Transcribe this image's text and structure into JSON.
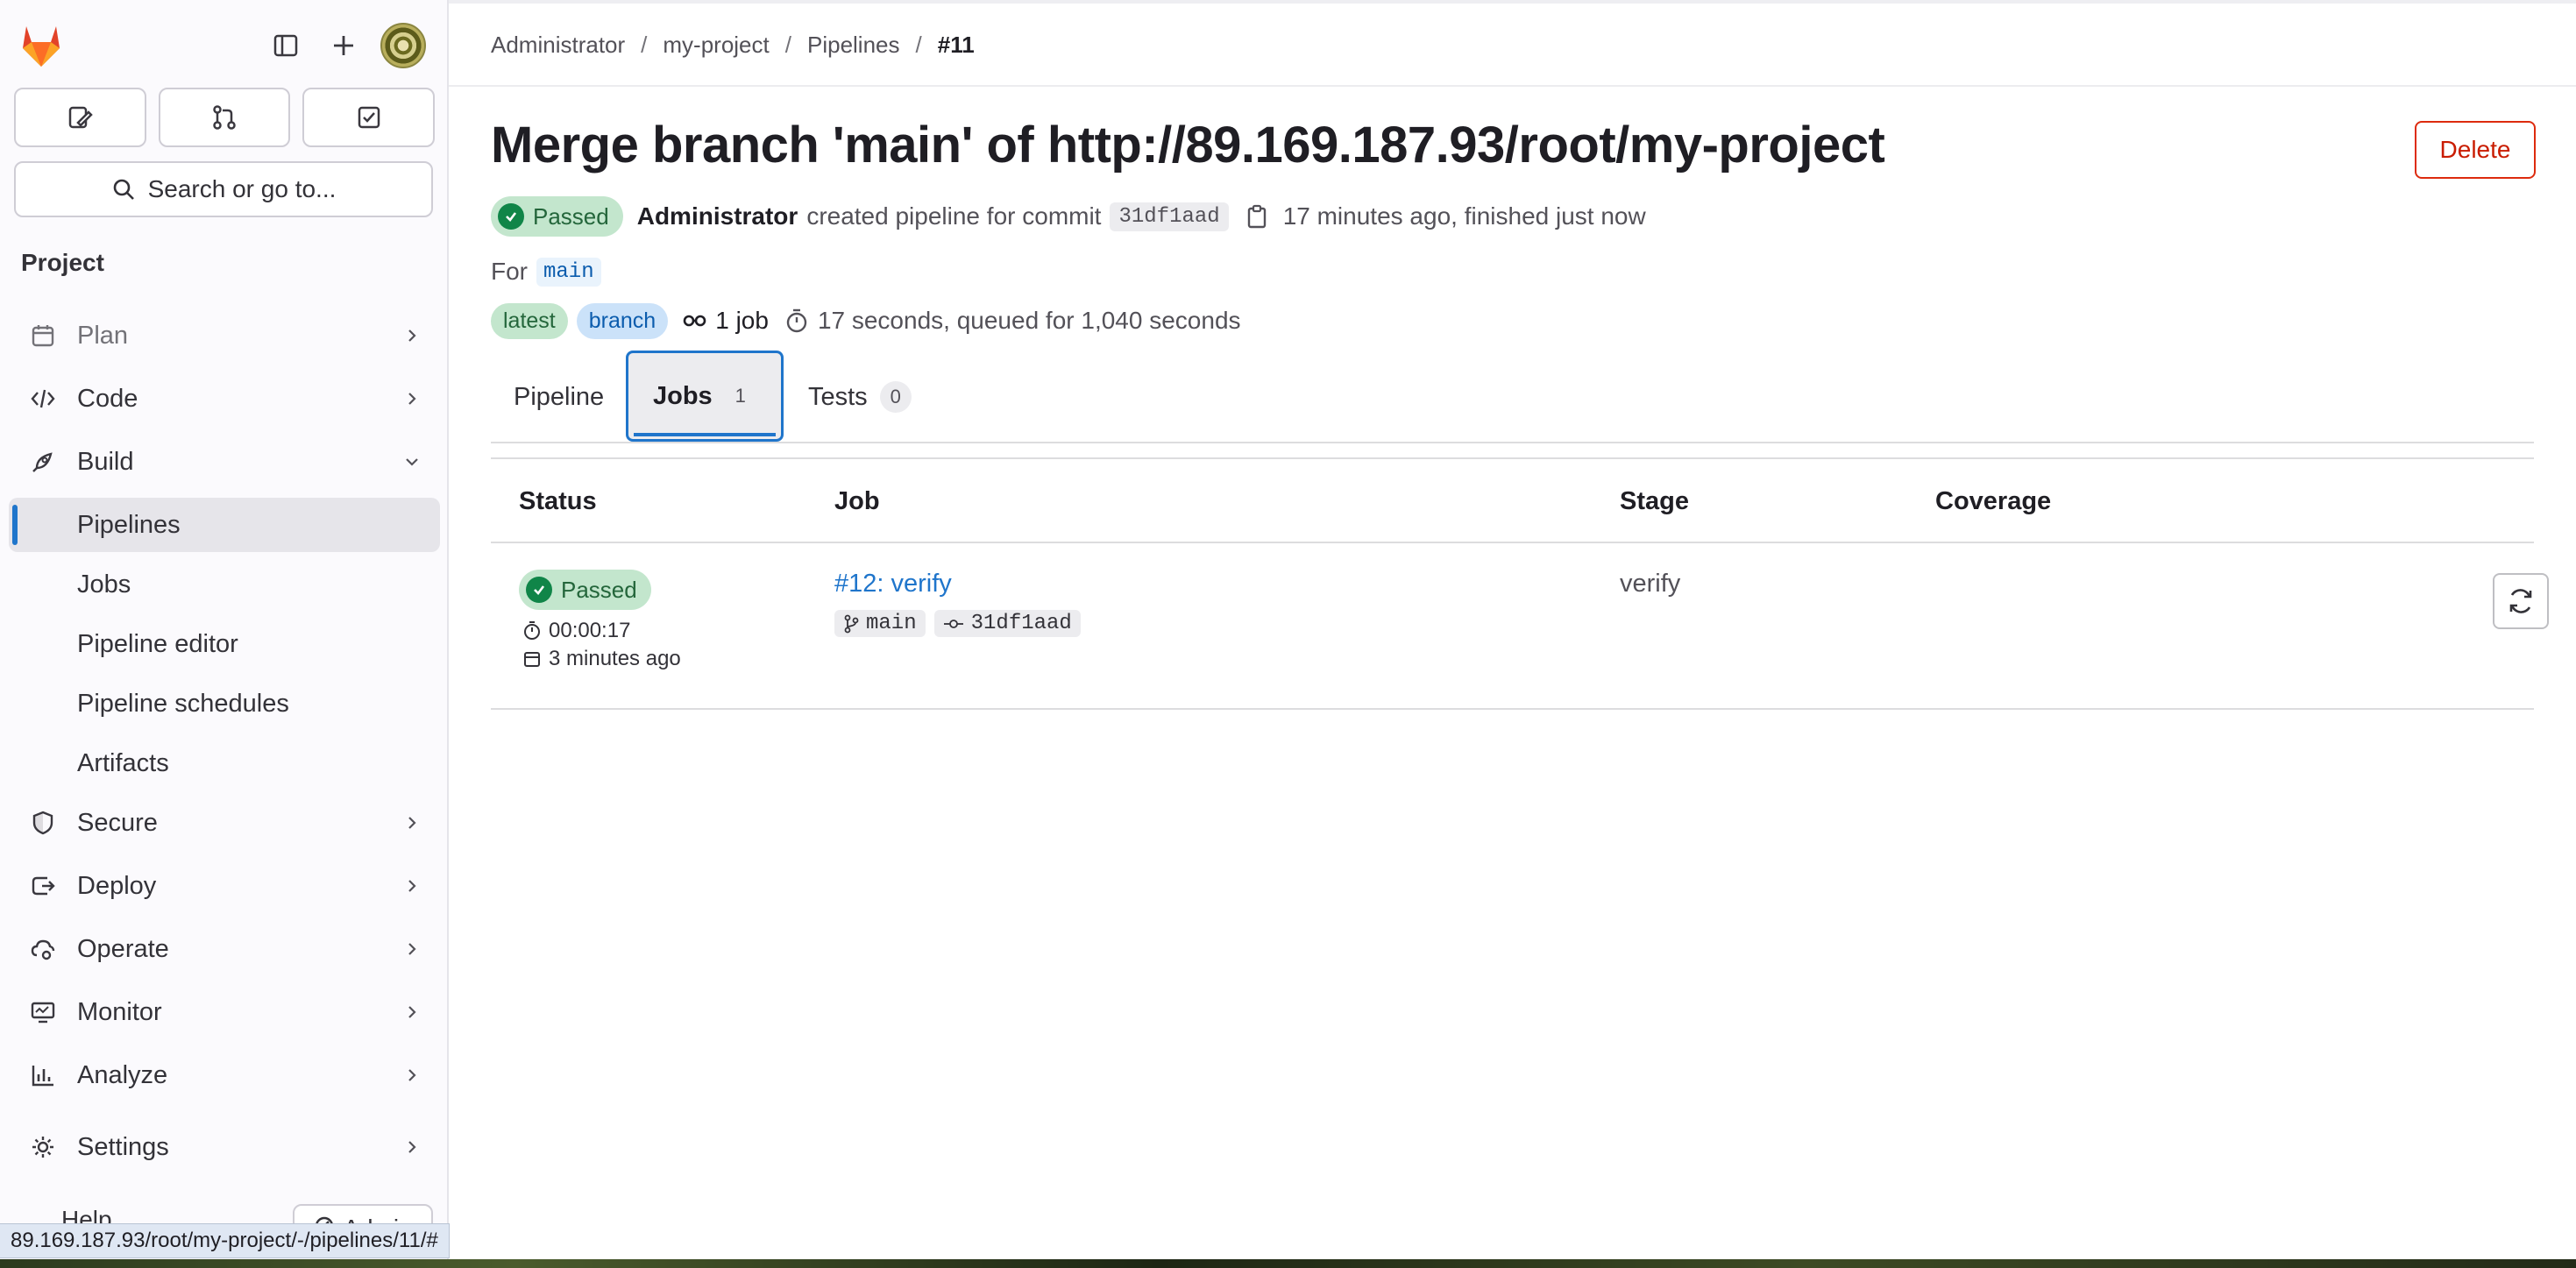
{
  "sidebar": {
    "section_title": "Project",
    "search_label": "Search or go to...",
    "nav": [
      {
        "label": "Plan",
        "icon": "calendar-icon"
      },
      {
        "label": "Code",
        "icon": "code-icon"
      },
      {
        "label": "Build",
        "icon": "rocket-icon"
      },
      {
        "label": "Secure",
        "icon": "shield-icon"
      },
      {
        "label": "Deploy",
        "icon": "deploy-icon"
      },
      {
        "label": "Operate",
        "icon": "cloud-gear-icon"
      },
      {
        "label": "Monitor",
        "icon": "monitor-icon"
      },
      {
        "label": "Analyze",
        "icon": "chart-icon"
      },
      {
        "label": "Settings",
        "icon": "gear-icon"
      }
    ],
    "build_subitems": [
      "Pipelines",
      "Jobs",
      "Pipeline editor",
      "Pipeline schedules",
      "Artifacts"
    ],
    "help_label": "Help",
    "admin_label": "Admin"
  },
  "breadcrumb": {
    "items": [
      "Administrator",
      "my-project",
      "Pipelines",
      "#11"
    ]
  },
  "header": {
    "title": "Merge branch 'main' of http://89.169.187.93/root/my-project",
    "delete_label": "Delete",
    "status": "Passed",
    "author": "Administrator",
    "action_text": "created pipeline for commit",
    "commit_sha": "31df1aad",
    "time_text": "17 minutes ago, finished just now",
    "for_label": "For",
    "branch": "main",
    "tag_latest": "latest",
    "tag_branch": "branch",
    "jobs_count": "1 job",
    "duration_text": "17 seconds, queued for 1,040 seconds"
  },
  "tabs": [
    {
      "label": "Pipeline",
      "count": null
    },
    {
      "label": "Jobs",
      "count": "1"
    },
    {
      "label": "Tests",
      "count": "0"
    }
  ],
  "table": {
    "headers": [
      "Status",
      "Job",
      "Stage",
      "Coverage"
    ],
    "rows": [
      {
        "status": "Passed",
        "duration": "00:00:17",
        "finished": "3 minutes ago",
        "job": "#12: verify",
        "ref": "main",
        "commit": "31df1aad",
        "stage": "verify",
        "coverage": ""
      }
    ]
  },
  "status_bar": {
    "url": "89.169.187.93/root/my-project/-/pipelines/11/#"
  },
  "colors": {
    "accent": "#1f75cb",
    "success": "#108548",
    "danger": "#dd2b0e"
  }
}
